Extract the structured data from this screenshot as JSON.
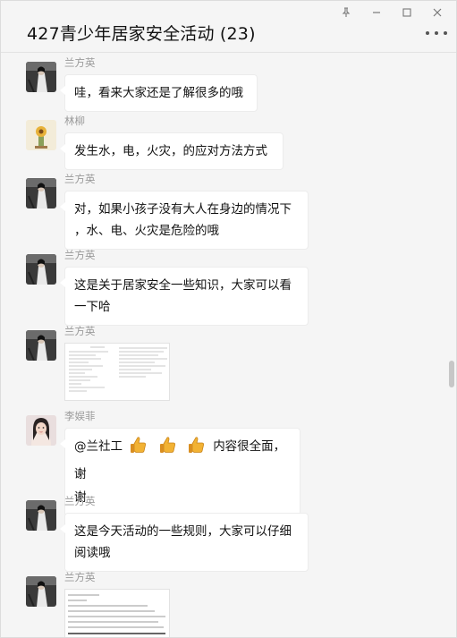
{
  "window": {
    "title": "427青少年居家安全活动 (23)",
    "controls": [
      "pin-icon",
      "minimize-icon",
      "maximize-icon",
      "close-icon"
    ]
  },
  "messages": [
    {
      "sender": "兰方英",
      "avatar": "avatar-lanfangying",
      "text": "哇，看来大家还是了解很多的哦"
    },
    {
      "sender": "林柳",
      "avatar": "avatar-linliu",
      "text": "发生水，电，火灾，的应对方法方式"
    },
    {
      "sender": "兰方英",
      "avatar": "avatar-lanfangying",
      "line1": "对，如果小孩子没有大人在身边的情况下",
      "line2": "，水、电、火灾是危险的哦"
    },
    {
      "sender": "兰方英",
      "avatar": "avatar-lanfangying",
      "line1": "这是关于居家安全一些知识，大家可以看",
      "line2": "一下哈"
    },
    {
      "sender": "兰方英",
      "avatar": "avatar-lanfangying",
      "type": "image"
    },
    {
      "sender": "李娱菲",
      "avatar": "avatar-liyufei",
      "mention": "@兰社工",
      "after": "内容很全面，谢",
      "line2": "谢"
    },
    {
      "sender": "兰方英",
      "avatar": "avatar-lanfangying",
      "line1": "这是今天活动的一些规则，大家可以仔细",
      "line2": "阅读哦"
    },
    {
      "sender": "兰方英",
      "avatar": "avatar-lanfangying",
      "type": "image"
    }
  ],
  "colors": {
    "background": "#f5f5f5",
    "bubble": "#ffffff",
    "sender_name": "#9a9a9a"
  }
}
